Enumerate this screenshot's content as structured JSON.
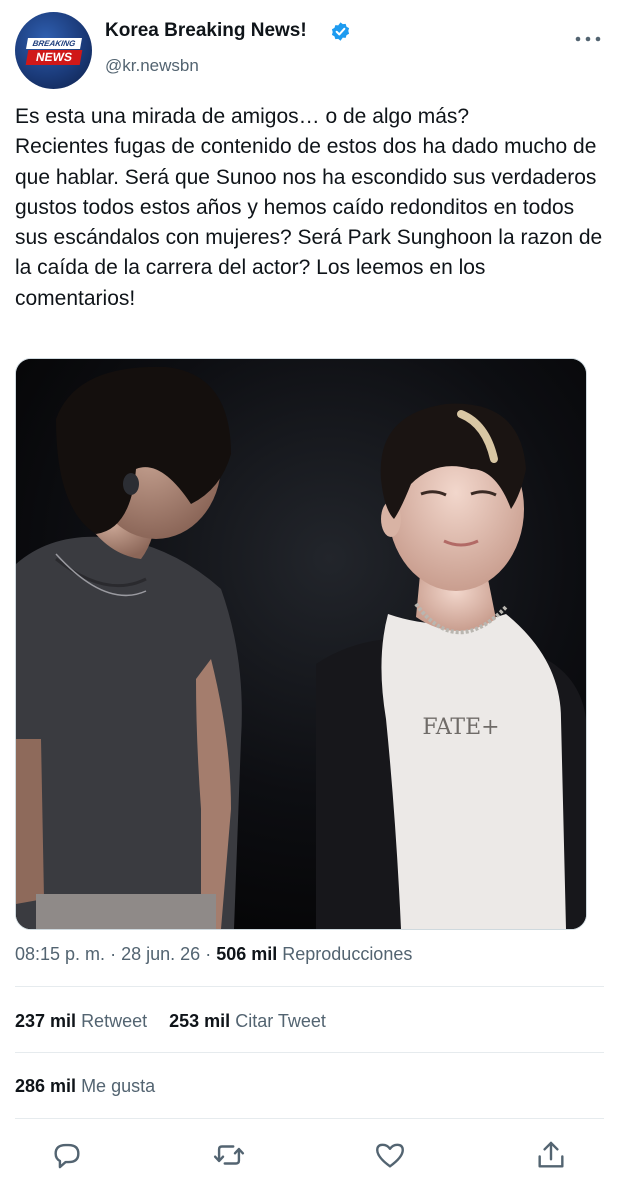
{
  "author": {
    "display_name": "Korea Breaking News!",
    "handle": "@kr.newsbn",
    "verified": true,
    "avatar": {
      "top_text": "BREAKING",
      "bottom_text": "NEWS"
    }
  },
  "tweet": {
    "text": "Es esta una mirada de amigos… o de algo más?\nRecientes fugas de contenido de estos dos ha dado mucho de que hablar. Será que Sunoo nos ha escondido sus verdaderos gustos todos estos años y hemos caído redonditos en todos sus escándalos con mujeres? Será Park Sunghoon la razon de la caída de la carrera del actor? Los leemos en los comentarios!",
    "shirt_print": "FATE+"
  },
  "meta": {
    "time": "08:15 p. m.",
    "separator": "·",
    "date": "28 jun. 26",
    "views": "506 mil",
    "views_label": "Reproducciones"
  },
  "stats": {
    "retweets": "237 mil",
    "retweets_label": "Retweet",
    "quotes": "253 mil",
    "quotes_label": "Citar Tweet",
    "likes": "286 mil",
    "likes_label": "Me gusta"
  },
  "actions": {
    "reply_icon": "reply-icon",
    "retweet_icon": "retweet-icon",
    "like_icon": "heart-icon",
    "share_icon": "share-icon"
  },
  "colors": {
    "verified": "#1d9bf0",
    "secondary_text": "#536471",
    "primary_text": "#0f1419"
  }
}
